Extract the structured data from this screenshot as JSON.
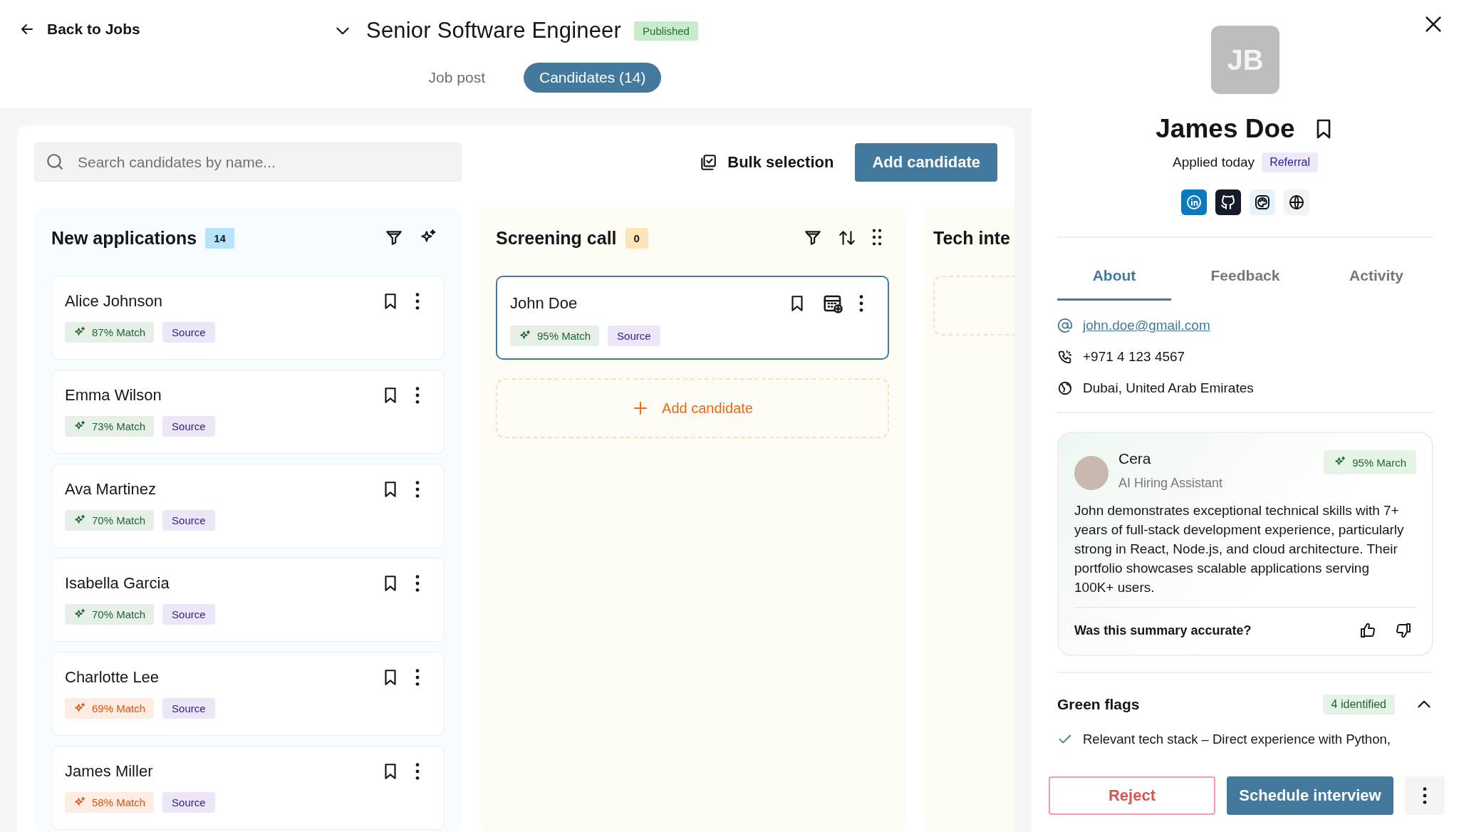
{
  "header": {
    "back_label": "Back to Jobs",
    "job_title": "Senior Software Engineer",
    "status_badge": "Published"
  },
  "tabs": [
    {
      "label": "Job post",
      "selected": false
    },
    {
      "label": "Candidates (14)",
      "selected": true
    }
  ],
  "toolbar": {
    "search": {
      "placeholder": "Search candidates by name..."
    },
    "bulk_label": "Bulk selection",
    "add_button": "Add candidate"
  },
  "columns": [
    {
      "title": "New applications",
      "count": "14",
      "color": "#b8e4fb",
      "tools": [
        {
          "kind": "filter"
        },
        {
          "kind": "sparkle"
        }
      ],
      "cards": [
        {
          "name": "Alice Johnson",
          "match": "87% Match",
          "color": "#20662f",
          "source": "Source",
          "selected": false,
          "has_schedule": false
        },
        {
          "name": "Emma Wilson",
          "match": "73% Match",
          "color": "#20662f",
          "source": "Source",
          "selected": false,
          "has_schedule": false
        },
        {
          "name": "Ava Martinez",
          "match": "70% Match",
          "color": "#20662f",
          "source": "Source",
          "selected": false,
          "has_schedule": false
        },
        {
          "name": "Isabella Garcia",
          "match": "70% Match",
          "color": "#20662f",
          "source": "Source",
          "selected": false,
          "has_schedule": false
        },
        {
          "name": "Charlotte Lee",
          "match": "69% Match",
          "color": "#e2520c",
          "source": "Source",
          "selected": false,
          "has_schedule": false
        },
        {
          "name": "James Miller",
          "match": "58% Match",
          "color": "#e2520c",
          "source": "Source",
          "selected": false,
          "has_schedule": false
        }
      ]
    },
    {
      "title": "Screening call",
      "count": "0",
      "color": "#fde4b8",
      "tools": [
        {
          "kind": "filter"
        },
        {
          "kind": "sort"
        },
        {
          "kind": "grip"
        }
      ],
      "cards": [
        {
          "name": "John Doe",
          "match": "95% Match",
          "color": "#20662f",
          "source": "Source",
          "selected": true,
          "has_schedule": true
        }
      ],
      "add_label": "Add candidate"
    },
    {
      "title": "Tech inte",
      "placeholder_slot": true
    }
  ],
  "profile": {
    "initials": "JB",
    "name": "James Doe",
    "applied": "Applied today",
    "source_badge": "Referral",
    "links": [
      {
        "kind": "linkedin"
      },
      {
        "kind": "github"
      },
      {
        "kind": "portfolio"
      },
      {
        "kind": "website"
      }
    ],
    "tabs": [
      {
        "label": "About",
        "selected": true
      },
      {
        "label": "Feedback",
        "selected": false
      },
      {
        "label": "Activity",
        "selected": false
      }
    ],
    "contacts": [
      {
        "kind": "email",
        "text": "john.doe@gmail.com"
      },
      {
        "kind": "phone",
        "text": "+971 4 123 4567"
      },
      {
        "kind": "location",
        "text": "Dubai, United Arab Emirates"
      }
    ],
    "assistant": {
      "name": "Cera",
      "role": "AI Hiring Assistant",
      "match": "95% March",
      "summary": "John demonstrates exceptional technical skills with 7+ years of full-stack development experience, particularly strong in React, Node.js, and cloud architecture. Their portfolio showcases scalable applications serving 100K+ users.",
      "question": "Was this summary accurate?"
    },
    "green_flags": {
      "title": "Green flags",
      "count": "4 identified",
      "expanded": true,
      "items": [
        "Relevant tech stack – Direct experience with Python,"
      ]
    },
    "actions": {
      "reject": "Reject",
      "schedule": "Schedule interview"
    }
  }
}
